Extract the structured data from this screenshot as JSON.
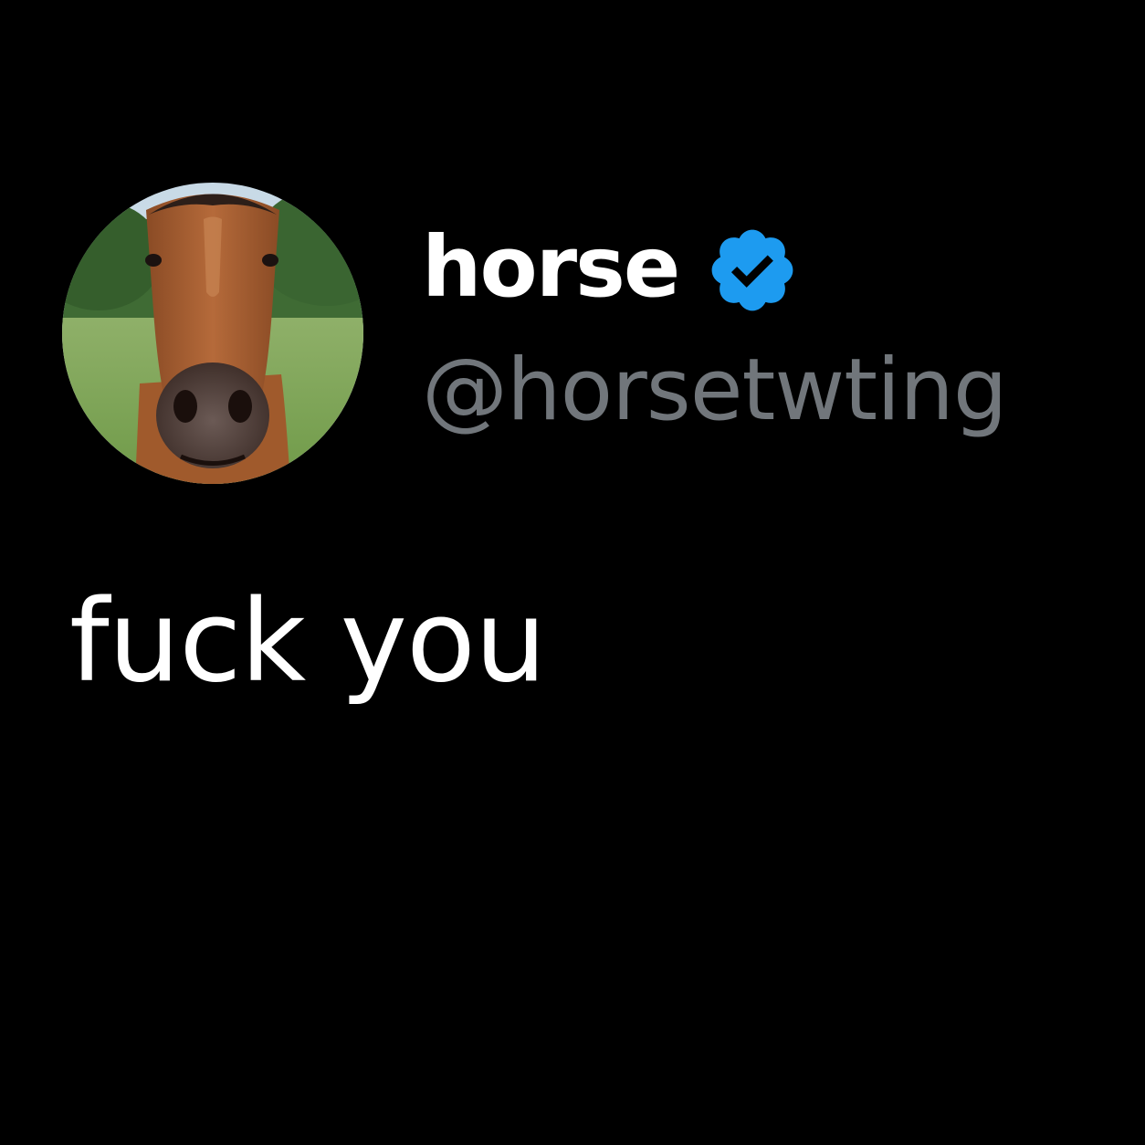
{
  "author": {
    "display_name": "horse",
    "handle": "@horsetwting",
    "verified": true,
    "avatar_icon": "horse-face-photo"
  },
  "tweet": {
    "text": "fuck you"
  },
  "colors": {
    "background": "#000000",
    "name": "#ffffff",
    "handle": "#71767b",
    "text": "#ffffff",
    "verified": "#1d9bf0"
  }
}
